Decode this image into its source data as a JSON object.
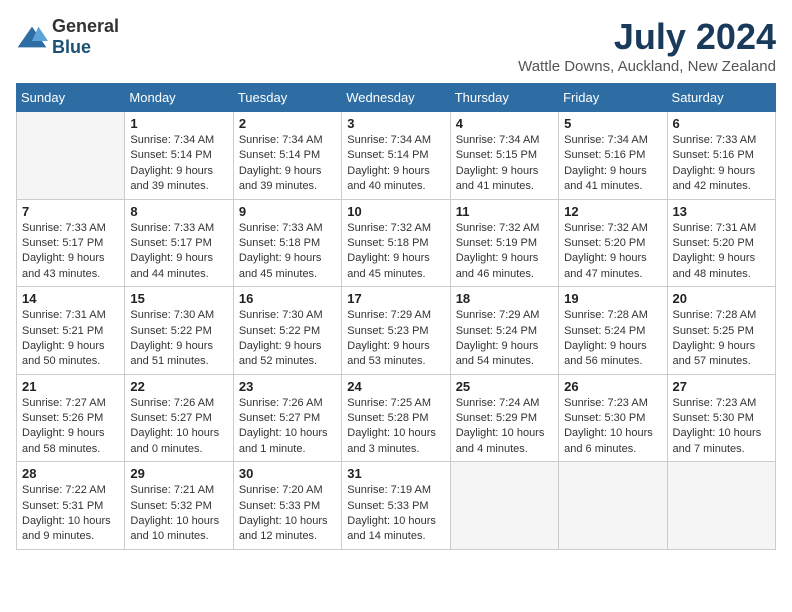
{
  "logo": {
    "general": "General",
    "blue": "Blue"
  },
  "header": {
    "month": "July 2024",
    "location": "Wattle Downs, Auckland, New Zealand"
  },
  "weekdays": [
    "Sunday",
    "Monday",
    "Tuesday",
    "Wednesday",
    "Thursday",
    "Friday",
    "Saturday"
  ],
  "weeks": [
    [
      {
        "day": "",
        "empty": true
      },
      {
        "day": "1",
        "sunrise": "7:34 AM",
        "sunset": "5:14 PM",
        "daylight": "9 hours and 39 minutes."
      },
      {
        "day": "2",
        "sunrise": "7:34 AM",
        "sunset": "5:14 PM",
        "daylight": "9 hours and 39 minutes."
      },
      {
        "day": "3",
        "sunrise": "7:34 AM",
        "sunset": "5:14 PM",
        "daylight": "9 hours and 40 minutes."
      },
      {
        "day": "4",
        "sunrise": "7:34 AM",
        "sunset": "5:15 PM",
        "daylight": "9 hours and 41 minutes."
      },
      {
        "day": "5",
        "sunrise": "7:34 AM",
        "sunset": "5:16 PM",
        "daylight": "9 hours and 41 minutes."
      },
      {
        "day": "6",
        "sunrise": "7:33 AM",
        "sunset": "5:16 PM",
        "daylight": "9 hours and 42 minutes."
      }
    ],
    [
      {
        "day": "7",
        "sunrise": "7:33 AM",
        "sunset": "5:17 PM",
        "daylight": "9 hours and 43 minutes."
      },
      {
        "day": "8",
        "sunrise": "7:33 AM",
        "sunset": "5:17 PM",
        "daylight": "9 hours and 44 minutes."
      },
      {
        "day": "9",
        "sunrise": "7:33 AM",
        "sunset": "5:18 PM",
        "daylight": "9 hours and 45 minutes."
      },
      {
        "day": "10",
        "sunrise": "7:32 AM",
        "sunset": "5:18 PM",
        "daylight": "9 hours and 45 minutes."
      },
      {
        "day": "11",
        "sunrise": "7:32 AM",
        "sunset": "5:19 PM",
        "daylight": "9 hours and 46 minutes."
      },
      {
        "day": "12",
        "sunrise": "7:32 AM",
        "sunset": "5:20 PM",
        "daylight": "9 hours and 47 minutes."
      },
      {
        "day": "13",
        "sunrise": "7:31 AM",
        "sunset": "5:20 PM",
        "daylight": "9 hours and 48 minutes."
      }
    ],
    [
      {
        "day": "14",
        "sunrise": "7:31 AM",
        "sunset": "5:21 PM",
        "daylight": "9 hours and 50 minutes."
      },
      {
        "day": "15",
        "sunrise": "7:30 AM",
        "sunset": "5:22 PM",
        "daylight": "9 hours and 51 minutes."
      },
      {
        "day": "16",
        "sunrise": "7:30 AM",
        "sunset": "5:22 PM",
        "daylight": "9 hours and 52 minutes."
      },
      {
        "day": "17",
        "sunrise": "7:29 AM",
        "sunset": "5:23 PM",
        "daylight": "9 hours and 53 minutes."
      },
      {
        "day": "18",
        "sunrise": "7:29 AM",
        "sunset": "5:24 PM",
        "daylight": "9 hours and 54 minutes."
      },
      {
        "day": "19",
        "sunrise": "7:28 AM",
        "sunset": "5:24 PM",
        "daylight": "9 hours and 56 minutes."
      },
      {
        "day": "20",
        "sunrise": "7:28 AM",
        "sunset": "5:25 PM",
        "daylight": "9 hours and 57 minutes."
      }
    ],
    [
      {
        "day": "21",
        "sunrise": "7:27 AM",
        "sunset": "5:26 PM",
        "daylight": "9 hours and 58 minutes."
      },
      {
        "day": "22",
        "sunrise": "7:26 AM",
        "sunset": "5:27 PM",
        "daylight": "10 hours and 0 minutes."
      },
      {
        "day": "23",
        "sunrise": "7:26 AM",
        "sunset": "5:27 PM",
        "daylight": "10 hours and 1 minute."
      },
      {
        "day": "24",
        "sunrise": "7:25 AM",
        "sunset": "5:28 PM",
        "daylight": "10 hours and 3 minutes."
      },
      {
        "day": "25",
        "sunrise": "7:24 AM",
        "sunset": "5:29 PM",
        "daylight": "10 hours and 4 minutes."
      },
      {
        "day": "26",
        "sunrise": "7:23 AM",
        "sunset": "5:30 PM",
        "daylight": "10 hours and 6 minutes."
      },
      {
        "day": "27",
        "sunrise": "7:23 AM",
        "sunset": "5:30 PM",
        "daylight": "10 hours and 7 minutes."
      }
    ],
    [
      {
        "day": "28",
        "sunrise": "7:22 AM",
        "sunset": "5:31 PM",
        "daylight": "10 hours and 9 minutes."
      },
      {
        "day": "29",
        "sunrise": "7:21 AM",
        "sunset": "5:32 PM",
        "daylight": "10 hours and 10 minutes."
      },
      {
        "day": "30",
        "sunrise": "7:20 AM",
        "sunset": "5:33 PM",
        "daylight": "10 hours and 12 minutes."
      },
      {
        "day": "31",
        "sunrise": "7:19 AM",
        "sunset": "5:33 PM",
        "daylight": "10 hours and 14 minutes."
      },
      {
        "day": "",
        "empty": true
      },
      {
        "day": "",
        "empty": true
      },
      {
        "day": "",
        "empty": true
      }
    ]
  ]
}
